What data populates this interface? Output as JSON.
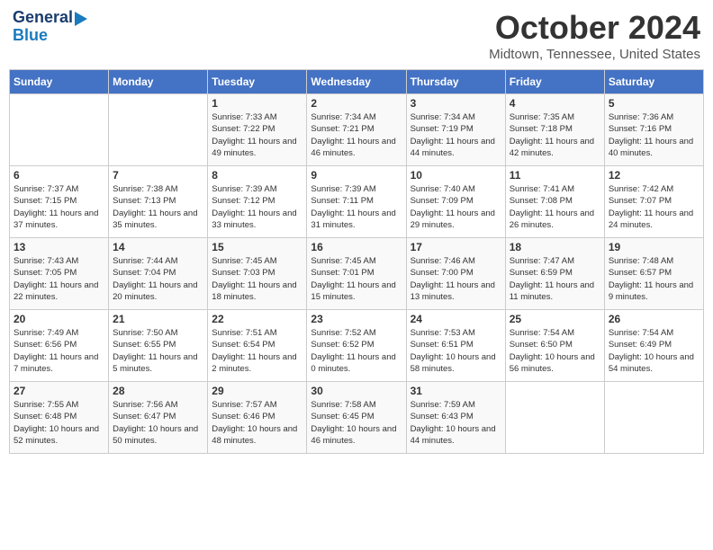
{
  "header": {
    "logo_general": "General",
    "logo_blue": "Blue",
    "title": "October 2024",
    "location": "Midtown, Tennessee, United States"
  },
  "weekdays": [
    "Sunday",
    "Monday",
    "Tuesday",
    "Wednesday",
    "Thursday",
    "Friday",
    "Saturday"
  ],
  "weeks": [
    [
      {
        "day": "",
        "info": ""
      },
      {
        "day": "",
        "info": ""
      },
      {
        "day": "1",
        "info": "Sunrise: 7:33 AM\nSunset: 7:22 PM\nDaylight: 11 hours and 49 minutes."
      },
      {
        "day": "2",
        "info": "Sunrise: 7:34 AM\nSunset: 7:21 PM\nDaylight: 11 hours and 46 minutes."
      },
      {
        "day": "3",
        "info": "Sunrise: 7:34 AM\nSunset: 7:19 PM\nDaylight: 11 hours and 44 minutes."
      },
      {
        "day": "4",
        "info": "Sunrise: 7:35 AM\nSunset: 7:18 PM\nDaylight: 11 hours and 42 minutes."
      },
      {
        "day": "5",
        "info": "Sunrise: 7:36 AM\nSunset: 7:16 PM\nDaylight: 11 hours and 40 minutes."
      }
    ],
    [
      {
        "day": "6",
        "info": "Sunrise: 7:37 AM\nSunset: 7:15 PM\nDaylight: 11 hours and 37 minutes."
      },
      {
        "day": "7",
        "info": "Sunrise: 7:38 AM\nSunset: 7:13 PM\nDaylight: 11 hours and 35 minutes."
      },
      {
        "day": "8",
        "info": "Sunrise: 7:39 AM\nSunset: 7:12 PM\nDaylight: 11 hours and 33 minutes."
      },
      {
        "day": "9",
        "info": "Sunrise: 7:39 AM\nSunset: 7:11 PM\nDaylight: 11 hours and 31 minutes."
      },
      {
        "day": "10",
        "info": "Sunrise: 7:40 AM\nSunset: 7:09 PM\nDaylight: 11 hours and 29 minutes."
      },
      {
        "day": "11",
        "info": "Sunrise: 7:41 AM\nSunset: 7:08 PM\nDaylight: 11 hours and 26 minutes."
      },
      {
        "day": "12",
        "info": "Sunrise: 7:42 AM\nSunset: 7:07 PM\nDaylight: 11 hours and 24 minutes."
      }
    ],
    [
      {
        "day": "13",
        "info": "Sunrise: 7:43 AM\nSunset: 7:05 PM\nDaylight: 11 hours and 22 minutes."
      },
      {
        "day": "14",
        "info": "Sunrise: 7:44 AM\nSunset: 7:04 PM\nDaylight: 11 hours and 20 minutes."
      },
      {
        "day": "15",
        "info": "Sunrise: 7:45 AM\nSunset: 7:03 PM\nDaylight: 11 hours and 18 minutes."
      },
      {
        "day": "16",
        "info": "Sunrise: 7:45 AM\nSunset: 7:01 PM\nDaylight: 11 hours and 15 minutes."
      },
      {
        "day": "17",
        "info": "Sunrise: 7:46 AM\nSunset: 7:00 PM\nDaylight: 11 hours and 13 minutes."
      },
      {
        "day": "18",
        "info": "Sunrise: 7:47 AM\nSunset: 6:59 PM\nDaylight: 11 hours and 11 minutes."
      },
      {
        "day": "19",
        "info": "Sunrise: 7:48 AM\nSunset: 6:57 PM\nDaylight: 11 hours and 9 minutes."
      }
    ],
    [
      {
        "day": "20",
        "info": "Sunrise: 7:49 AM\nSunset: 6:56 PM\nDaylight: 11 hours and 7 minutes."
      },
      {
        "day": "21",
        "info": "Sunrise: 7:50 AM\nSunset: 6:55 PM\nDaylight: 11 hours and 5 minutes."
      },
      {
        "day": "22",
        "info": "Sunrise: 7:51 AM\nSunset: 6:54 PM\nDaylight: 11 hours and 2 minutes."
      },
      {
        "day": "23",
        "info": "Sunrise: 7:52 AM\nSunset: 6:52 PM\nDaylight: 11 hours and 0 minutes."
      },
      {
        "day": "24",
        "info": "Sunrise: 7:53 AM\nSunset: 6:51 PM\nDaylight: 10 hours and 58 minutes."
      },
      {
        "day": "25",
        "info": "Sunrise: 7:54 AM\nSunset: 6:50 PM\nDaylight: 10 hours and 56 minutes."
      },
      {
        "day": "26",
        "info": "Sunrise: 7:54 AM\nSunset: 6:49 PM\nDaylight: 10 hours and 54 minutes."
      }
    ],
    [
      {
        "day": "27",
        "info": "Sunrise: 7:55 AM\nSunset: 6:48 PM\nDaylight: 10 hours and 52 minutes."
      },
      {
        "day": "28",
        "info": "Sunrise: 7:56 AM\nSunset: 6:47 PM\nDaylight: 10 hours and 50 minutes."
      },
      {
        "day": "29",
        "info": "Sunrise: 7:57 AM\nSunset: 6:46 PM\nDaylight: 10 hours and 48 minutes."
      },
      {
        "day": "30",
        "info": "Sunrise: 7:58 AM\nSunset: 6:45 PM\nDaylight: 10 hours and 46 minutes."
      },
      {
        "day": "31",
        "info": "Sunrise: 7:59 AM\nSunset: 6:43 PM\nDaylight: 10 hours and 44 minutes."
      },
      {
        "day": "",
        "info": ""
      },
      {
        "day": "",
        "info": ""
      }
    ]
  ]
}
